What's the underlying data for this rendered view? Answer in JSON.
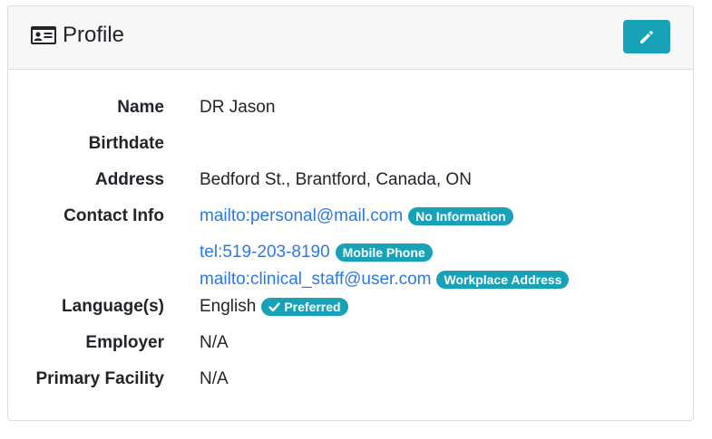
{
  "header": {
    "title": "Profile",
    "icon": "id-card-icon",
    "edit_icon": "pencil-icon",
    "accent_color": "#17a2b8"
  },
  "fields": {
    "name": {
      "label": "Name",
      "value": "DR Jason"
    },
    "birthdate": {
      "label": "Birthdate",
      "value": ""
    },
    "address": {
      "label": "Address",
      "value": "Bedford St., Brantford, Canada, ON"
    },
    "contact": {
      "label": "Contact Info",
      "items": [
        {
          "value": "mailto:personal@mail.com",
          "badge": "No Information"
        },
        {
          "value": "tel:519-203-8190",
          "badge": "Mobile Phone"
        },
        {
          "value": "mailto:clinical_staff@user.com",
          "badge": "Workplace Address"
        }
      ]
    },
    "language": {
      "label": "Language(s)",
      "value": "English",
      "badge": "Preferred",
      "badge_icon": "check-icon"
    },
    "employer": {
      "label": "Employer",
      "value": "N/A"
    },
    "facility": {
      "label": "Primary Facility",
      "value": "N/A"
    }
  }
}
